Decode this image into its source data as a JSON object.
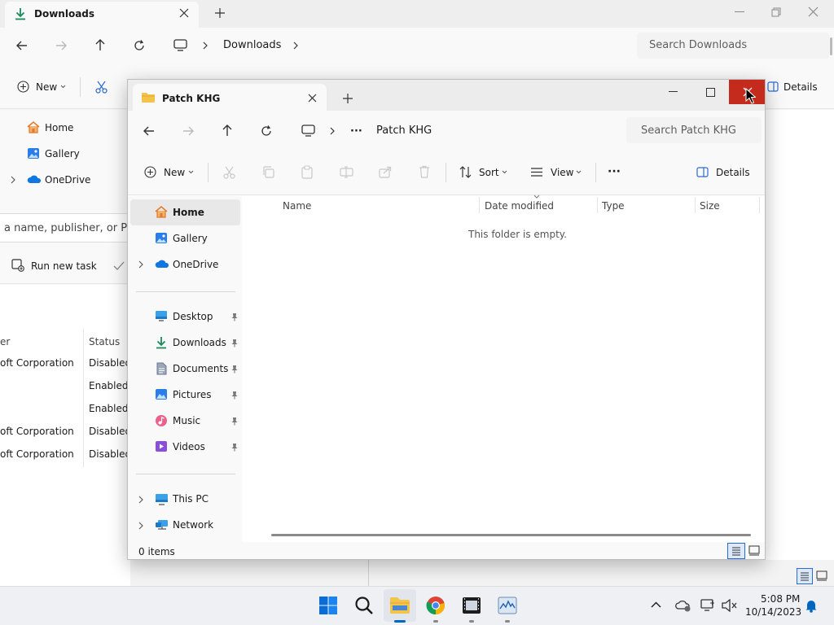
{
  "background_window": {
    "tab_title": "Downloads",
    "breadcrumb": "Downloads",
    "search_placeholder": "Search Downloads",
    "toolbar_new": "New",
    "details_label": "Details",
    "nav": {
      "home": "Home",
      "gallery": "Gallery",
      "onedrive": "OneDrive"
    }
  },
  "task_manager": {
    "search_placeholder": "a name, publisher, or PID",
    "run_new_task": "Run new task",
    "columns": {
      "publisher": "er",
      "status": "Status"
    },
    "rows": [
      {
        "publisher": "oft Corporation",
        "status": "Disabled"
      },
      {
        "publisher": "",
        "status": "Enabled"
      },
      {
        "publisher": "",
        "status": "Enabled"
      },
      {
        "publisher": "oft Corporation",
        "status": "Disabled"
      },
      {
        "publisher": "oft Corporation",
        "status": "Disabled"
      }
    ]
  },
  "foreground_window": {
    "tab_title": "Patch KHG",
    "breadcrumb_ellipsis": "···",
    "breadcrumb": "Patch KHG",
    "search_placeholder": "Search Patch KHG",
    "toolbar": {
      "new": "New",
      "sort": "Sort",
      "view": "View",
      "more": "···",
      "details": "Details"
    },
    "nav": {
      "home": "Home",
      "gallery": "Gallery",
      "onedrive": "OneDrive",
      "desktop": "Desktop",
      "downloads": "Downloads",
      "documents": "Documents",
      "pictures": "Pictures",
      "music": "Music",
      "videos": "Videos",
      "thispc": "This PC",
      "network": "Network"
    },
    "columns": {
      "name": "Name",
      "date_modified": "Date modified",
      "type": "Type",
      "size": "Size"
    },
    "empty_message": "This folder is empty.",
    "status_items": "0 items"
  },
  "taskbar": {
    "time": "5:08 PM",
    "date": "10/14/2023"
  },
  "colors": {
    "accent": "#0067c0",
    "close_hover": "#c42b1c",
    "folder_yellow": "#f4c34a"
  }
}
